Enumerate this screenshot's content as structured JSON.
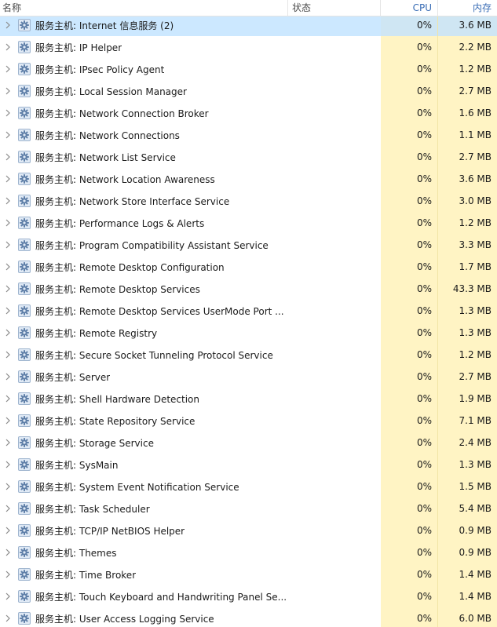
{
  "columns": {
    "name": "名称",
    "status": "状态",
    "cpu": "CPU",
    "memory": "内存"
  },
  "colors": {
    "selected_row": "#cce8ff",
    "heat_cell": "#fff4c4",
    "header_accent": "#3a6db5"
  },
  "icons": {
    "expand": "chevron-right-icon",
    "service": "gear-icon"
  },
  "rows": [
    {
      "name": "服务主机: Internet 信息服务 (2)",
      "cpu": "0%",
      "mem": "3.6 MB",
      "selected": true
    },
    {
      "name": "服务主机: IP Helper",
      "cpu": "0%",
      "mem": "2.2 MB"
    },
    {
      "name": "服务主机: IPsec Policy Agent",
      "cpu": "0%",
      "mem": "1.2 MB"
    },
    {
      "name": "服务主机: Local Session Manager",
      "cpu": "0%",
      "mem": "2.7 MB"
    },
    {
      "name": "服务主机: Network Connection Broker",
      "cpu": "0%",
      "mem": "1.6 MB"
    },
    {
      "name": "服务主机: Network Connections",
      "cpu": "0%",
      "mem": "1.1 MB"
    },
    {
      "name": "服务主机: Network List Service",
      "cpu": "0%",
      "mem": "2.7 MB"
    },
    {
      "name": "服务主机: Network Location Awareness",
      "cpu": "0%",
      "mem": "3.6 MB"
    },
    {
      "name": "服务主机: Network Store Interface Service",
      "cpu": "0%",
      "mem": "3.0 MB"
    },
    {
      "name": "服务主机: Performance Logs & Alerts",
      "cpu": "0%",
      "mem": "1.2 MB"
    },
    {
      "name": "服务主机: Program Compatibility Assistant Service",
      "cpu": "0%",
      "mem": "3.3 MB"
    },
    {
      "name": "服务主机: Remote Desktop Configuration",
      "cpu": "0%",
      "mem": "1.7 MB"
    },
    {
      "name": "服务主机: Remote Desktop Services",
      "cpu": "0%",
      "mem": "43.3 MB"
    },
    {
      "name": "服务主机: Remote Desktop Services UserMode Port ...",
      "cpu": "0%",
      "mem": "1.3 MB"
    },
    {
      "name": "服务主机: Remote Registry",
      "cpu": "0%",
      "mem": "1.3 MB"
    },
    {
      "name": "服务主机: Secure Socket Tunneling Protocol Service",
      "cpu": "0%",
      "mem": "1.2 MB"
    },
    {
      "name": "服务主机: Server",
      "cpu": "0%",
      "mem": "2.7 MB"
    },
    {
      "name": "服务主机: Shell Hardware Detection",
      "cpu": "0%",
      "mem": "1.9 MB"
    },
    {
      "name": "服务主机: State Repository Service",
      "cpu": "0%",
      "mem": "7.1 MB"
    },
    {
      "name": "服务主机: Storage Service",
      "cpu": "0%",
      "mem": "2.4 MB"
    },
    {
      "name": "服务主机: SysMain",
      "cpu": "0%",
      "mem": "1.3 MB"
    },
    {
      "name": "服务主机: System Event Notification Service",
      "cpu": "0%",
      "mem": "1.5 MB"
    },
    {
      "name": "服务主机: Task Scheduler",
      "cpu": "0%",
      "mem": "5.4 MB"
    },
    {
      "name": "服务主机: TCP/IP NetBIOS Helper",
      "cpu": "0%",
      "mem": "0.9 MB"
    },
    {
      "name": "服务主机: Themes",
      "cpu": "0%",
      "mem": "0.9 MB"
    },
    {
      "name": "服务主机: Time Broker",
      "cpu": "0%",
      "mem": "1.4 MB"
    },
    {
      "name": "服务主机: Touch Keyboard and Handwriting Panel Se...",
      "cpu": "0%",
      "mem": "1.4 MB"
    },
    {
      "name": "服务主机: User Access Logging Service",
      "cpu": "0%",
      "mem": "6.0 MB"
    }
  ]
}
